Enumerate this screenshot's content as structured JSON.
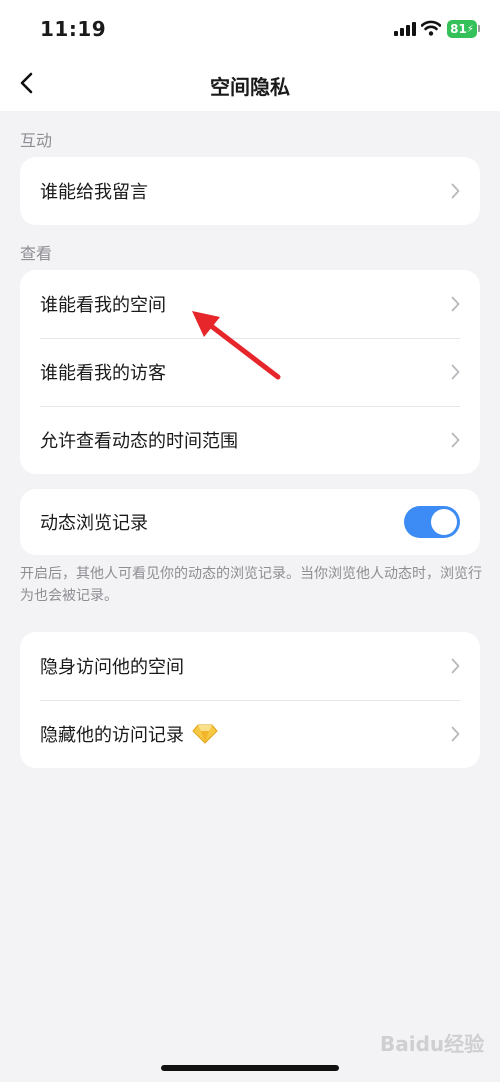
{
  "status_bar": {
    "time": "11:19",
    "battery": "81"
  },
  "nav": {
    "title": "空间隐私",
    "back_icon": "chevron-left-icon"
  },
  "sections": {
    "interaction_label": "互动",
    "interaction_items": [
      "谁能给我留言"
    ],
    "view_label": "查看",
    "view_items": [
      "谁能看我的空间",
      "谁能看我的访客",
      "允许查看动态的时间范围"
    ]
  },
  "browse_record": {
    "label": "动态浏览记录",
    "toggle_on": true,
    "note": "开启后，其他人可看见你的动态的浏览记录。当你浏览他人动态时，浏览行为也会被记录。"
  },
  "stealth": {
    "items": [
      "隐身访问他的空间",
      "隐藏他的访问记录"
    ],
    "badge_icon": "diamond-icon"
  },
  "colors": {
    "accent": "#3d8cf5",
    "annotation": "#e6262a",
    "battery": "#35c15a"
  },
  "watermark": "Baidu经验"
}
